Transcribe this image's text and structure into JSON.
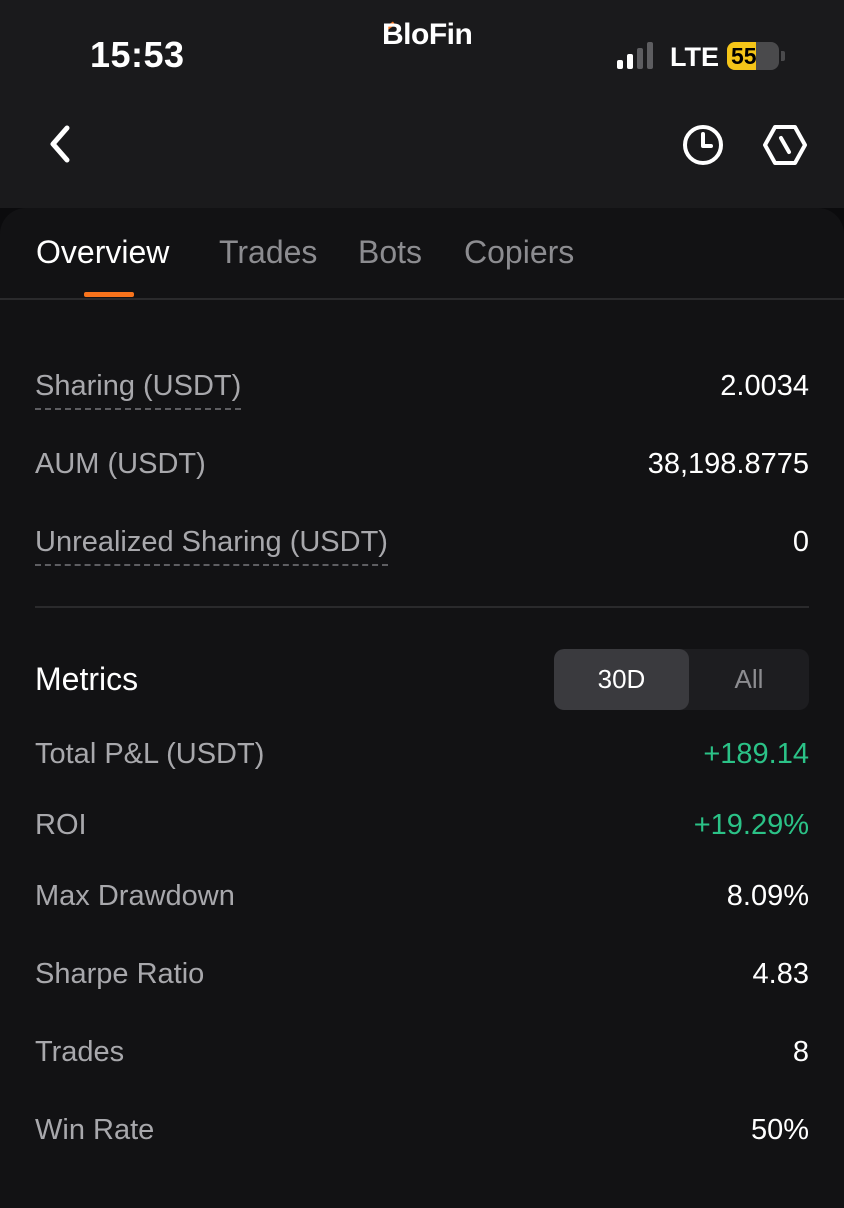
{
  "status_bar": {
    "time": "15:53",
    "carrier_brand": "BloFin",
    "network": "LTE",
    "battery": "55",
    "battery_level": 0.55
  },
  "header": {
    "back_icon": "chevron-left-icon",
    "history_icon": "clock-icon",
    "share_icon": "hexagon-share-icon"
  },
  "tabs": [
    {
      "label": "Overview",
      "active": true
    },
    {
      "label": "Trades",
      "active": false
    },
    {
      "label": "Bots",
      "active": false
    },
    {
      "label": "Copiers",
      "active": false
    }
  ],
  "overview": {
    "sharing": {
      "label": "Sharing (USDT)",
      "value": "2.0034"
    },
    "aum": {
      "label": "AUM (USDT)",
      "value": "38,198.8775"
    },
    "unrealized_sharing": {
      "label": "Unrealized Sharing (USDT)",
      "value": "0"
    }
  },
  "metrics": {
    "title": "Metrics",
    "range_options": [
      "30D",
      "All"
    ],
    "selected_range": "30D",
    "rows": {
      "total_pnl": {
        "label": "Total P&L (USDT)",
        "value": "+189.14"
      },
      "roi": {
        "label": "ROI",
        "value": "+19.29%"
      },
      "max_drawdown": {
        "label": "Max Drawdown",
        "value": "8.09%"
      },
      "sharpe_ratio": {
        "label": "Sharpe Ratio",
        "value": "4.83"
      },
      "trades": {
        "label": "Trades",
        "value": "8"
      },
      "win_rate": {
        "label": "Win Rate",
        "value": "50%"
      }
    }
  },
  "colors": {
    "accent": "#f7731c",
    "positive": "#2bc287",
    "background": "#121214",
    "header_background": "#1a1a1c"
  }
}
